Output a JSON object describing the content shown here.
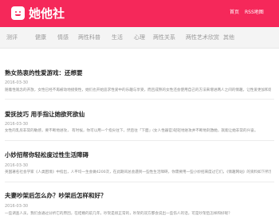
{
  "header": {
    "site_name": "她他社",
    "links": [
      "首页",
      "RSS地图"
    ],
    "brand_color": "#f5285a",
    "logo_icon": "smile-bag-icon"
  },
  "nav": {
    "items": [
      "测评",
      "健康",
      "情感",
      "两性科普",
      "生活",
      "心理",
      "两性关系",
      "两性艺术欣赏",
      "其他"
    ]
  },
  "articles": [
    {
      "title": "熟女热衷的性爱游戏：还想要",
      "date": "2016-03-30",
      "summary": "随着性观念的开放，女性已经不再被动地接受性，她们也开始追求性爱中的乐趣与享受，而且成熟的女性还会使用自己的方法来增进两人之间的情趣，让性爱更加和谐美满。"
    },
    {
      "title": "爱抚技巧 用手指让她欲死欲仙",
      "date": "2016-03-30",
      "summary": "女性的乳房非常的敏感，要不断地进攻，     有时候，你可以用一个指尖往下，然后往「下面」(女人性器官)轻轻地进攻并不断地刺激她，就能让她非常的兴奋。"
    },
    {
      "title": "小妙招帮你轻松度过性生活障碍",
      "date": "2016-03-30",
      "summary": "英国著名社会学家《人类困境》中指出，人平均一生会做4200次，在此期间总会遇到一些性生活障碍，你需要用一些小妙招来度过它们，《情趣网站》的资料如下所示。"
    },
    {
      "title": "夫妻吵架后怎么办？吵架后怎样和好？",
      "date": "2016-03-30",
      "summary": "一些调查人员，我们会通过分析它的原因，在结婚的前几年，吵架是很正常的，吵架的双方都会说出一些伤人的话，可是吵架后怎样和好呢？"
    }
  ]
}
